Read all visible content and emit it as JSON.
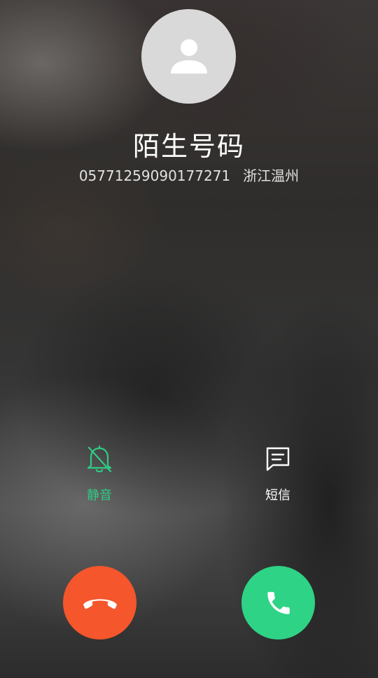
{
  "caller": {
    "name": "陌生号码",
    "number": "05771259090177271",
    "location": "浙江温州"
  },
  "actions": {
    "mute_label": "静音",
    "sms_label": "短信"
  },
  "colors": {
    "accent_green": "#2fcc83",
    "decline_red": "#f5562b",
    "answer_green": "#2ed385",
    "avatar_gray": "#d9d9d9"
  },
  "icons": {
    "avatar": "person-icon",
    "mute": "bell-off-icon",
    "sms": "message-icon",
    "decline": "hang-up-icon",
    "answer": "phone-icon"
  }
}
